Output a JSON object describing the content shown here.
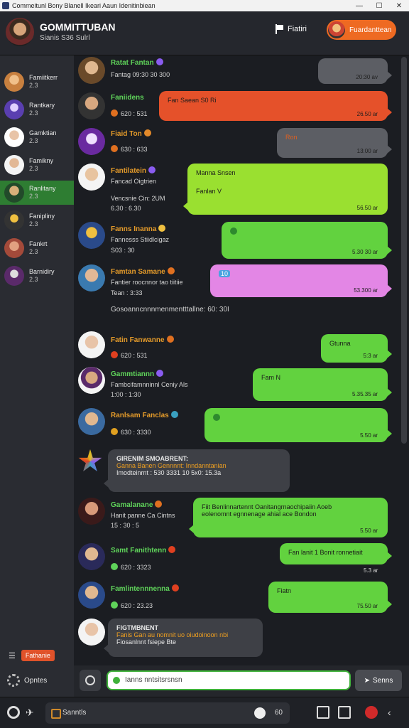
{
  "window": {
    "title": "Commeitunl Bony Blanell Ikeari Aaun Idenitinbiean",
    "min": "—",
    "max": "☐",
    "close": "✕"
  },
  "header": {
    "name": "GOMMITTUBAN",
    "subtitle": "Sianis S36 Sulrl",
    "flag_label": "Fiatiri",
    "profile_label": "Fuardanttean"
  },
  "sidebar": {
    "contacts": [
      {
        "name": "Famiitkerr",
        "count": "2.3",
        "color": "#c8803f"
      },
      {
        "name": "Rantkary",
        "count": "2.3",
        "color": "#5a3fb0"
      },
      {
        "name": "Gamktian",
        "count": "2.3",
        "color": "#c99b7c"
      },
      {
        "name": "Famikny",
        "count": "2.3",
        "color": "#3b3b3b"
      },
      {
        "name": "Ranlitany",
        "count": "2.3",
        "color": "#2e6a3a",
        "active": true
      },
      {
        "name": "Fanipliny",
        "count": "2.3",
        "color": "#8a6b2a"
      },
      {
        "name": "Fankrt",
        "count": "2.3",
        "color": "#a44a3a"
      },
      {
        "name": "Barnidiry",
        "count": "2.3",
        "color": "#5a2a6a"
      }
    ],
    "footer_label": "Fathanie",
    "settings_label": "Opntes"
  },
  "messages": [
    {
      "name": "Ratat Fantan",
      "name_color": "#5fd35a",
      "line1": "Fantag 09:30 30 300",
      "line2": "",
      "bubble_text": "",
      "bubble_text2": "",
      "time": "20:30 av",
      "style": "gray",
      "side": "right"
    },
    {
      "name": "Faniidens",
      "name_color": "#5fd35a",
      "line1": "620 : 531",
      "line2": "",
      "bubble_text": "Fan   Saean  S0  Ri",
      "bubble_text2": "",
      "time": "26.50 ar",
      "style": "orange",
      "side": "right"
    },
    {
      "name": "Fiaid Ton",
      "name_color": "#e39a2a",
      "line1": "630 : 633",
      "line2": "",
      "bubble_text": "Ron",
      "bubble_text2": "",
      "time": "13:00 ar",
      "style": "gray",
      "side": "right"
    },
    {
      "name": "Fantilatein",
      "name_color": "#e39a2a",
      "line1": "Fancad Oigtrien",
      "line2": "Vencsnie Cin: 2UM",
      "line3": "6.30 : 6.30",
      "bubble_text": "Manna  Snsen",
      "bubble_text2": "Fanlan  V",
      "time": "56.50 ar",
      "style": "lime",
      "side": "left"
    },
    {
      "name": "Fanns Inanna",
      "name_color": "#e39a2a",
      "line1": "Fannesss  Stiidlcigaz",
      "line2": "S03 : 30",
      "bubble_text": "",
      "bubble_text2": "",
      "time": "5.30 30 ar",
      "style": "green",
      "side": "right"
    },
    {
      "name": "Famtan Samane",
      "name_color": "#e39a2a",
      "line1": "Fantier roocnnor tao tiitiie",
      "line2": "Tean : 3:33",
      "bubble_text": "10",
      "bubble_text2": "",
      "time": "53.300 ar",
      "style": "pink",
      "side": "right"
    },
    {
      "name": "Fatin Fanwanne",
      "name_color": "#e39a2a",
      "line1": "620 : 531",
      "line2": "",
      "bubble_text": "Gtunna",
      "bubble_text2": "",
      "time": "5:3 ar",
      "style": "green",
      "side": "right"
    },
    {
      "name": "Gammtiannn",
      "name_color": "#5fd35a",
      "line1": "Fambcifamnninnl Ceniy Als",
      "line2": "1:00 : 1:30",
      "bubble_text": "Fam  N",
      "bubble_text2": "",
      "time": "5.35.35 ar",
      "style": "green",
      "side": "right"
    },
    {
      "name": "Ranlsam Fanclas",
      "name_color": "#e39a2a",
      "line1": "630 : 3330",
      "line2": "",
      "bubble_text": "",
      "bubble_text2": "",
      "time": "5.50 ar",
      "style": "green",
      "side": "right"
    },
    {
      "name": "Gamalanane",
      "name_color": "#5fd35a",
      "line1": "Hanit panne Ca Cintns",
      "line2": "15 : 30 : 5",
      "bubble_text": "Fiit   Benlinnartennt  Oanitangrnaochipaiin Aoeb",
      "bubble_text2": "eolenomnt egnnenage ahial ace Bondon",
      "time": "5.50 ar",
      "style": "green",
      "side": "left"
    },
    {
      "name": "Samt Fanithtenn",
      "name_color": "#5fd35a",
      "line1": "620 : 3323",
      "line2": "",
      "bubble_text": "Fan  lanit 1   Bonit    ronnetiait",
      "bubble_text2": "",
      "time": "5.3 ar",
      "style": "green",
      "side": "right"
    },
    {
      "name": "Famlintennnenna",
      "name_color": "#5fd35a",
      "line1": "620 : 23.23",
      "line2": "",
      "bubble_text": "Fiatn",
      "bubble_text2": "",
      "time": "75.50 ar",
      "style": "green",
      "side": "right"
    }
  ],
  "inline_notes": {
    "date_separator": "Gosoanncnnnmenmentttallne:  60: 30I",
    "card1_title": "GIRENIM   SMOABRENT:",
    "card1_line1": "Ganna  Banen   Gennnnt:   Inndanntanian",
    "card1_line2": "Imodteinrnt : 530 3331    10   5x0: 15.3a",
    "card2_title": "FIGTMBNENT",
    "card2_line1": "Fanis   Gan  au nomnit uo   oiudoinoon nbi",
    "card2_line2": "Fiosanlnnt   fsiepe  Bte"
  },
  "composer": {
    "placeholder": "Ianns nntsitsrsnsn",
    "send_label": "Senns"
  },
  "bottombar": {
    "search_label": "Sanntls",
    "count": "60"
  }
}
